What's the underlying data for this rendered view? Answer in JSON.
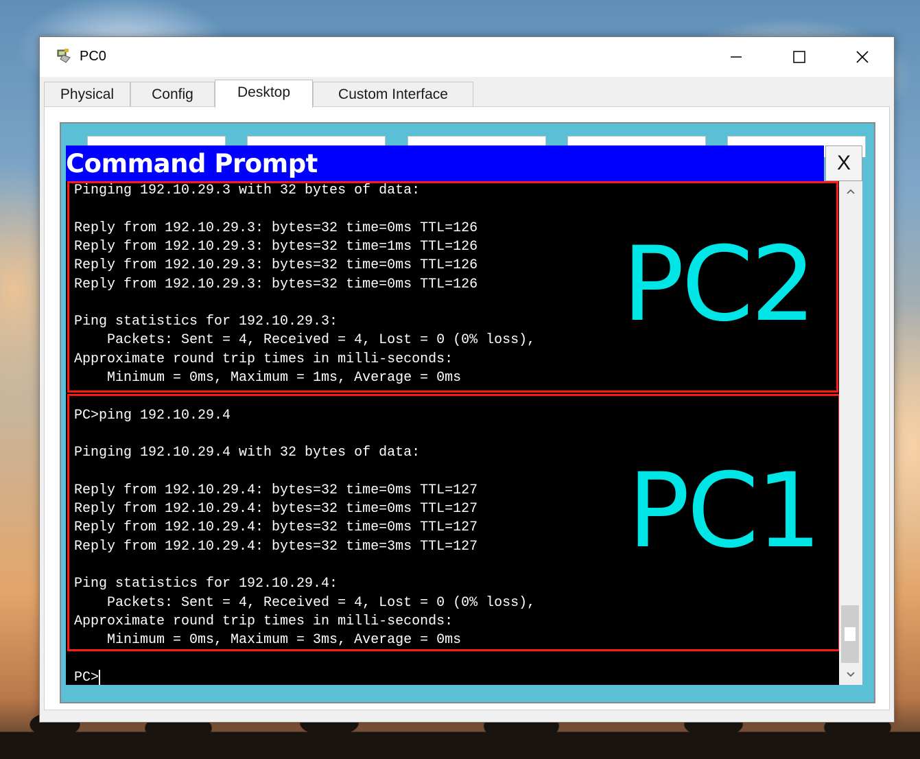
{
  "window": {
    "title": "PC0",
    "controls": {
      "minimize": "minimize-icon",
      "maximize": "maximize-icon",
      "close": "close-icon"
    }
  },
  "tabs": [
    {
      "label": "Physical",
      "active": false
    },
    {
      "label": "Config",
      "active": false
    },
    {
      "label": "Desktop",
      "active": true
    },
    {
      "label": "Custom Interface",
      "active": false
    }
  ],
  "command_prompt": {
    "title": "Command Prompt",
    "close_label": "X",
    "lines": [
      "Pinging 192.10.29.3 with 32 bytes of data:",
      "",
      "Reply from 192.10.29.3: bytes=32 time=0ms TTL=126",
      "Reply from 192.10.29.3: bytes=32 time=1ms TTL=126",
      "Reply from 192.10.29.3: bytes=32 time=0ms TTL=126",
      "Reply from 192.10.29.3: bytes=32 time=0ms TTL=126",
      "",
      "Ping statistics for 192.10.29.3:",
      "    Packets: Sent = 4, Received = 4, Lost = 0 (0% loss),",
      "Approximate round trip times in milli-seconds:",
      "    Minimum = 0ms, Maximum = 1ms, Average = 0ms",
      "",
      "PC>ping 192.10.29.4",
      "",
      "Pinging 192.10.29.4 with 32 bytes of data:",
      "",
      "Reply from 192.10.29.4: bytes=32 time=0ms TTL=127",
      "Reply from 192.10.29.4: bytes=32 time=0ms TTL=127",
      "Reply from 192.10.29.4: bytes=32 time=0ms TTL=127",
      "Reply from 192.10.29.4: bytes=32 time=3ms TTL=127",
      "",
      "Ping statistics for 192.10.29.4:",
      "    Packets: Sent = 4, Received = 4, Lost = 0 (0% loss),",
      "Approximate round trip times in milli-seconds:",
      "    Minimum = 0ms, Maximum = 3ms, Average = 0ms",
      "",
      "PC>"
    ]
  },
  "annotations": {
    "pc2_label": "PC2",
    "pc1_label": "PC1",
    "highlight_color": "#ff1a1a",
    "label_color": "#00e5e5"
  },
  "colors": {
    "cmd_title_bar": "#0000ff",
    "terminal_bg": "#000000",
    "desktop_frame": "#5bc0d6"
  }
}
